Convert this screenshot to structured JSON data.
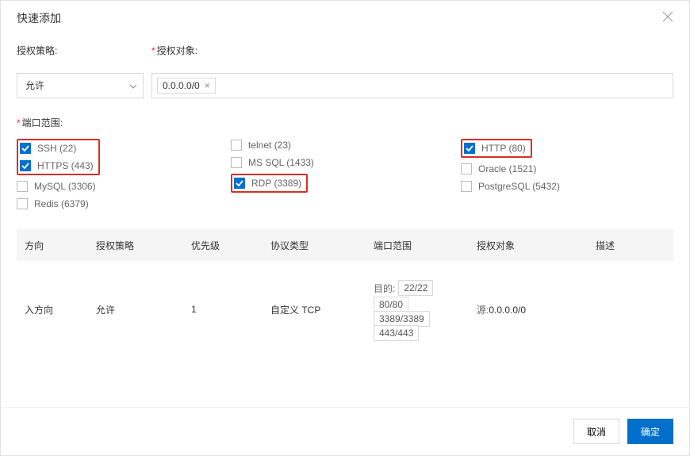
{
  "header": {
    "title": "快速添加"
  },
  "form": {
    "policy_label": "授权策略",
    "target_label": "授权对象",
    "policy_value": "允许",
    "target_tag": "0.0.0.0/0",
    "port_label": "端口范围"
  },
  "ports": {
    "col1": [
      {
        "label": "SSH (22)",
        "checked": true,
        "highlight": true
      },
      {
        "label": "HTTPS (443)",
        "checked": true,
        "highlight": true
      },
      {
        "label": "MySQL (3306)",
        "checked": false,
        "highlight": false
      },
      {
        "label": "Redis (6379)",
        "checked": false,
        "highlight": false
      }
    ],
    "col2": [
      {
        "label": "telnet (23)",
        "checked": false,
        "highlight": false
      },
      {
        "label": "MS SQL (1433)",
        "checked": false,
        "highlight": false
      },
      {
        "label": "RDP (3389)",
        "checked": true,
        "highlight": true
      }
    ],
    "col3": [
      {
        "label": "HTTP (80)",
        "checked": true,
        "highlight": true
      },
      {
        "label": "Oracle (1521)",
        "checked": false,
        "highlight": false
      },
      {
        "label": "PostgreSQL (5432)",
        "checked": false,
        "highlight": false
      }
    ]
  },
  "table": {
    "headers": {
      "dir": "方向",
      "policy": "授权策略",
      "prio": "优先级",
      "proto": "协议类型",
      "range": "端口范围",
      "target": "授权对象",
      "desc": "描述"
    },
    "row": {
      "dir": "入方向",
      "policy": "允许",
      "prio": "1",
      "proto": "自定义 TCP",
      "range_label": "目的:",
      "ranges": [
        "22/22",
        "80/80",
        "3389/3389",
        "443/443"
      ],
      "target_label": "源:",
      "target_value": "0.0.0.0/0"
    }
  },
  "footer": {
    "cancel": "取消",
    "ok": "确定"
  }
}
